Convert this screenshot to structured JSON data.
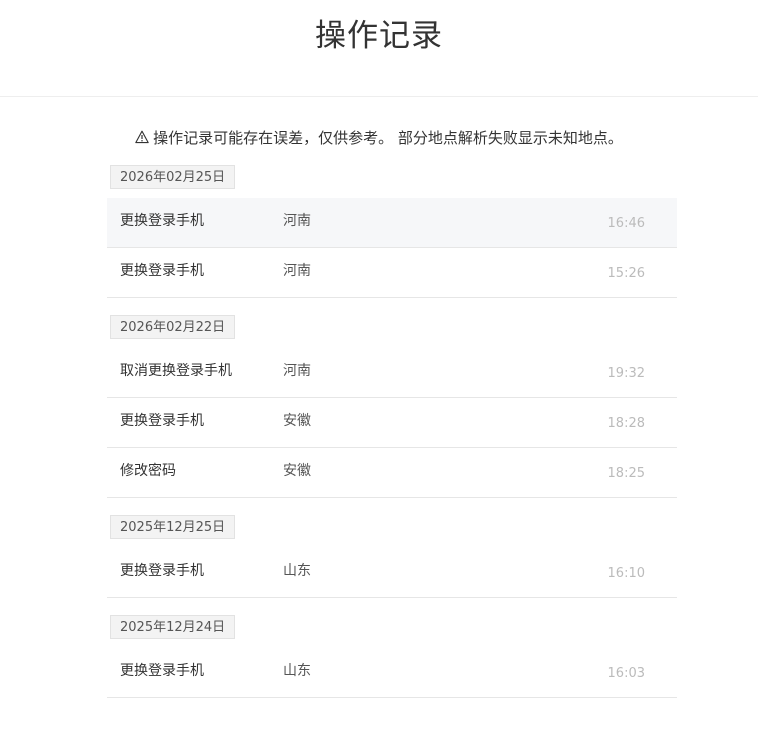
{
  "page": {
    "title": "操作记录",
    "notice": "操作记录可能存在误差，仅供参考。 部分地点解析失败显示未知地点。"
  },
  "groups": [
    {
      "date": "2026年02月25日",
      "records": [
        {
          "action": "更换登录手机",
          "location": "河南",
          "time": "16:46",
          "highlight": true
        },
        {
          "action": "更换登录手机",
          "location": "河南",
          "time": "15:26",
          "highlight": false
        }
      ]
    },
    {
      "date": "2026年02月22日",
      "records": [
        {
          "action": "取消更换登录手机",
          "location": "河南",
          "time": "19:32",
          "highlight": false
        },
        {
          "action": "更换登录手机",
          "location": "安徽",
          "time": "18:28",
          "highlight": false
        },
        {
          "action": "修改密码",
          "location": "安徽",
          "time": "18:25",
          "highlight": false
        }
      ]
    },
    {
      "date": "2025年12月25日",
      "records": [
        {
          "action": "更换登录手机",
          "location": "山东",
          "time": "16:10",
          "highlight": false
        }
      ]
    },
    {
      "date": "2025年12月24日",
      "records": [
        {
          "action": "更换登录手机",
          "location": "山东",
          "time": "16:03",
          "highlight": false
        }
      ]
    }
  ],
  "icons": {
    "notice_icon": "warning-icon"
  }
}
